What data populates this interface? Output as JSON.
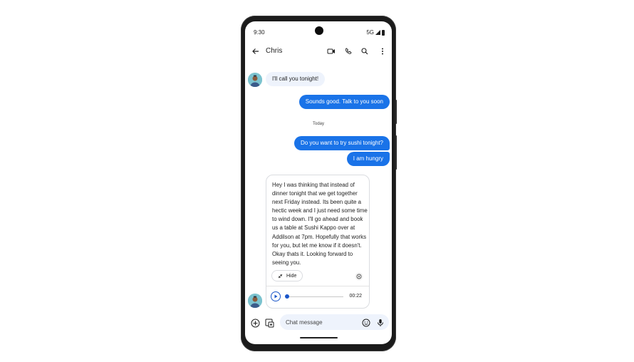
{
  "status_bar": {
    "time": "9:30",
    "network": "5G"
  },
  "app_bar": {
    "back_icon": "arrow-back-icon",
    "contact_name": "Chris",
    "actions": [
      "video-call-icon",
      "phone-icon",
      "search-icon",
      "more-vert-icon"
    ]
  },
  "messages": [
    {
      "direction": "incoming",
      "text": "I'll call you tonight!"
    },
    {
      "direction": "outgoing",
      "text": "Sounds good. Talk to you soon"
    },
    {
      "direction": "outgoing",
      "text": "Do you want to try sushi tonight?"
    },
    {
      "direction": "outgoing",
      "text": "I am hungry"
    }
  ],
  "date_separator": "Today",
  "voice_message": {
    "transcript": "Hey I was thinking that instead of dinner tonight that we get together next Friday instead. Its been quite a hectic week and I just need some time to wind down.  I'll go ahead and book us a table at Sushi Kappo over at Addilson at 7pm.  Hopefully that works for you, but let me know if it doesn't. Okay thats it. Looking forward to seeing you.",
    "hide_label": "Hide",
    "duration": "00:22",
    "progress": 0.0
  },
  "compose": {
    "placeholder": "Chat message",
    "icons": [
      "add-circle-icon",
      "gallery-icon",
      "emoji-icon",
      "mic-icon"
    ]
  },
  "colors": {
    "outgoing_bubble": "#1a73e8",
    "incoming_bubble": "#eef3fc",
    "accent": "#1a56c9"
  }
}
